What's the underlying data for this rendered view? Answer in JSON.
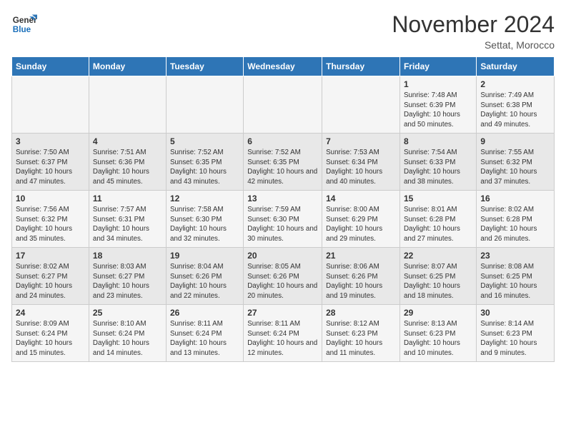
{
  "logo": {
    "line1": "General",
    "line2": "Blue"
  },
  "title": "November 2024",
  "location": "Settat, Morocco",
  "days_of_week": [
    "Sunday",
    "Monday",
    "Tuesday",
    "Wednesday",
    "Thursday",
    "Friday",
    "Saturday"
  ],
  "weeks": [
    [
      {
        "day": "",
        "info": ""
      },
      {
        "day": "",
        "info": ""
      },
      {
        "day": "",
        "info": ""
      },
      {
        "day": "",
        "info": ""
      },
      {
        "day": "",
        "info": ""
      },
      {
        "day": "1",
        "info": "Sunrise: 7:48 AM\nSunset: 6:39 PM\nDaylight: 10 hours and 50 minutes."
      },
      {
        "day": "2",
        "info": "Sunrise: 7:49 AM\nSunset: 6:38 PM\nDaylight: 10 hours and 49 minutes."
      }
    ],
    [
      {
        "day": "3",
        "info": "Sunrise: 7:50 AM\nSunset: 6:37 PM\nDaylight: 10 hours and 47 minutes."
      },
      {
        "day": "4",
        "info": "Sunrise: 7:51 AM\nSunset: 6:36 PM\nDaylight: 10 hours and 45 minutes."
      },
      {
        "day": "5",
        "info": "Sunrise: 7:52 AM\nSunset: 6:35 PM\nDaylight: 10 hours and 43 minutes."
      },
      {
        "day": "6",
        "info": "Sunrise: 7:52 AM\nSunset: 6:35 PM\nDaylight: 10 hours and 42 minutes."
      },
      {
        "day": "7",
        "info": "Sunrise: 7:53 AM\nSunset: 6:34 PM\nDaylight: 10 hours and 40 minutes."
      },
      {
        "day": "8",
        "info": "Sunrise: 7:54 AM\nSunset: 6:33 PM\nDaylight: 10 hours and 38 minutes."
      },
      {
        "day": "9",
        "info": "Sunrise: 7:55 AM\nSunset: 6:32 PM\nDaylight: 10 hours and 37 minutes."
      }
    ],
    [
      {
        "day": "10",
        "info": "Sunrise: 7:56 AM\nSunset: 6:32 PM\nDaylight: 10 hours and 35 minutes."
      },
      {
        "day": "11",
        "info": "Sunrise: 7:57 AM\nSunset: 6:31 PM\nDaylight: 10 hours and 34 minutes."
      },
      {
        "day": "12",
        "info": "Sunrise: 7:58 AM\nSunset: 6:30 PM\nDaylight: 10 hours and 32 minutes."
      },
      {
        "day": "13",
        "info": "Sunrise: 7:59 AM\nSunset: 6:30 PM\nDaylight: 10 hours and 30 minutes."
      },
      {
        "day": "14",
        "info": "Sunrise: 8:00 AM\nSunset: 6:29 PM\nDaylight: 10 hours and 29 minutes."
      },
      {
        "day": "15",
        "info": "Sunrise: 8:01 AM\nSunset: 6:28 PM\nDaylight: 10 hours and 27 minutes."
      },
      {
        "day": "16",
        "info": "Sunrise: 8:02 AM\nSunset: 6:28 PM\nDaylight: 10 hours and 26 minutes."
      }
    ],
    [
      {
        "day": "17",
        "info": "Sunrise: 8:02 AM\nSunset: 6:27 PM\nDaylight: 10 hours and 24 minutes."
      },
      {
        "day": "18",
        "info": "Sunrise: 8:03 AM\nSunset: 6:27 PM\nDaylight: 10 hours and 23 minutes."
      },
      {
        "day": "19",
        "info": "Sunrise: 8:04 AM\nSunset: 6:26 PM\nDaylight: 10 hours and 22 minutes."
      },
      {
        "day": "20",
        "info": "Sunrise: 8:05 AM\nSunset: 6:26 PM\nDaylight: 10 hours and 20 minutes."
      },
      {
        "day": "21",
        "info": "Sunrise: 8:06 AM\nSunset: 6:26 PM\nDaylight: 10 hours and 19 minutes."
      },
      {
        "day": "22",
        "info": "Sunrise: 8:07 AM\nSunset: 6:25 PM\nDaylight: 10 hours and 18 minutes."
      },
      {
        "day": "23",
        "info": "Sunrise: 8:08 AM\nSunset: 6:25 PM\nDaylight: 10 hours and 16 minutes."
      }
    ],
    [
      {
        "day": "24",
        "info": "Sunrise: 8:09 AM\nSunset: 6:24 PM\nDaylight: 10 hours and 15 minutes."
      },
      {
        "day": "25",
        "info": "Sunrise: 8:10 AM\nSunset: 6:24 PM\nDaylight: 10 hours and 14 minutes."
      },
      {
        "day": "26",
        "info": "Sunrise: 8:11 AM\nSunset: 6:24 PM\nDaylight: 10 hours and 13 minutes."
      },
      {
        "day": "27",
        "info": "Sunrise: 8:11 AM\nSunset: 6:24 PM\nDaylight: 10 hours and 12 minutes."
      },
      {
        "day": "28",
        "info": "Sunrise: 8:12 AM\nSunset: 6:23 PM\nDaylight: 10 hours and 11 minutes."
      },
      {
        "day": "29",
        "info": "Sunrise: 8:13 AM\nSunset: 6:23 PM\nDaylight: 10 hours and 10 minutes."
      },
      {
        "day": "30",
        "info": "Sunrise: 8:14 AM\nSunset: 6:23 PM\nDaylight: 10 hours and 9 minutes."
      }
    ]
  ]
}
